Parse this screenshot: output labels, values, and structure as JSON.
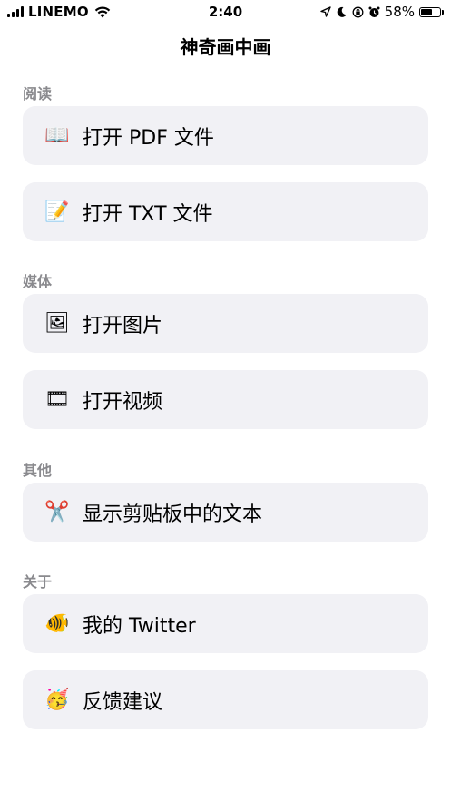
{
  "status_bar": {
    "carrier": "LINEMO",
    "time": "2:40",
    "battery_percent": "58%",
    "battery_level": 0.58
  },
  "nav": {
    "title": "神奇画中画"
  },
  "sections": [
    {
      "header": "阅读",
      "items": [
        {
          "icon": "📖",
          "icon_name": "book-icon",
          "label": "打开 PDF 文件"
        },
        {
          "icon": "📝",
          "icon_name": "memo-icon",
          "label": "打开 TXT 文件"
        }
      ]
    },
    {
      "header": "媒体",
      "items": [
        {
          "icon": "🖼",
          "icon_name": "picture-icon",
          "label": "打开图片"
        },
        {
          "icon": "🎞",
          "icon_name": "film-icon",
          "label": "打开视频"
        }
      ]
    },
    {
      "header": "其他",
      "items": [
        {
          "icon": "✂️",
          "icon_name": "scissors-icon",
          "label": "显示剪贴板中的文本"
        }
      ]
    },
    {
      "header": "关于",
      "items": [
        {
          "icon": "🐠",
          "icon_name": "fish-icon",
          "label": "我的 Twitter"
        },
        {
          "icon": "🥳",
          "icon_name": "party-face-icon",
          "label": "反馈建议"
        }
      ]
    }
  ]
}
